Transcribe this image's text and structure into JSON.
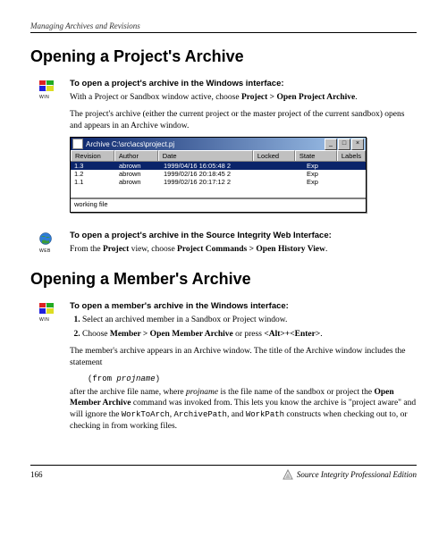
{
  "runningHeader": "Managing Archives and Revisions",
  "heading1": "Opening a Project's Archive",
  "win_label": "WIN",
  "web_label": "WEB",
  "sec1": {
    "lead": "To open a project's archive in the Windows interface:",
    "p1_a": "With a Project or Sandbox window active, choose ",
    "p1_b": "Project > Open Project Archive",
    "p1_c": ".",
    "p2": "The project's archive (either the current project or the master project of the current sandbox) opens and appears in an Archive window."
  },
  "window": {
    "title": "Archive C:\\src\\acs\\project.pj",
    "min": "_",
    "max": "□",
    "close": "×",
    "cols": {
      "rev": "Revision",
      "auth": "Author",
      "date": "Date",
      "lock": "Locked",
      "state": "State",
      "label": "Labels"
    },
    "rows": [
      {
        "rev": "1.3",
        "auth": "abrown",
        "date": "1999/04/16 16:05:48 2",
        "lock": "",
        "state": "Exp"
      },
      {
        "rev": "1.2",
        "auth": "abrown",
        "date": "1999/02/16 20:18:45 2",
        "lock": "",
        "state": "Exp"
      },
      {
        "rev": "1.1",
        "auth": "abrown",
        "date": "1999/02/16 20:17:12 2",
        "lock": "",
        "state": "Exp"
      }
    ],
    "lower": "working file"
  },
  "sec2": {
    "lead": "To open a project's archive in the Source Integrity Web Interface:",
    "p1_a": "From the ",
    "p1_b": "Project",
    "p1_c": " view, choose ",
    "p1_d": "Project Commands > Open History View",
    "p1_e": "."
  },
  "heading2": "Opening a Member's Archive",
  "sec3": {
    "lead": "To open a member's archive in the Windows interface:",
    "step1": "Select an archived member in a Sandbox or Project window.",
    "step2_a": "Choose ",
    "step2_b": "Member > Open Member Archive",
    "step2_c": " or press ",
    "step2_d": "<Alt>+<Enter>",
    "step2_e": ".",
    "p1": "The member's archive appears in an Archive window. The title of the Archive window includes the statement",
    "code_a": "(from ",
    "code_b": "projname",
    "code_c": ")",
    "p2_a": "after the archive file name, where ",
    "p2_b": "projname",
    "p2_c": " is the file name of the sandbox or project the ",
    "p2_d": "Open Member Archive",
    "p2_e": " command was invoked from. This lets you know the archive is \"project aware\" and will ignore the ",
    "p2_f": "WorkToArch",
    "p2_g": ", ",
    "p2_h": "ArchivePath",
    "p2_i": ", and ",
    "p2_j": "WorkPath",
    "p2_k": " constructs when checking out to, or checking in from working files."
  },
  "pageNumber": "166",
  "productName": "Source Integrity Professional Edition"
}
